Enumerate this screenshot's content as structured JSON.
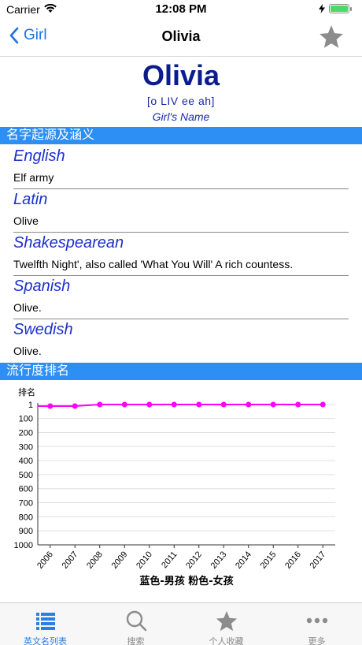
{
  "status": {
    "carrier": "Carrier",
    "time": "12:08 PM"
  },
  "nav": {
    "back_label": "Girl",
    "title": "Olivia"
  },
  "header": {
    "name": "Olivia",
    "pronunciation": "[o LIV ee ah]",
    "gender": "Girl's Name"
  },
  "sections": {
    "origin_title": "名字起源及涵义",
    "popularity_title": "流行度排名"
  },
  "origins": [
    {
      "language": "English",
      "meaning": "Elf army"
    },
    {
      "language": "Latin",
      "meaning": "Olive"
    },
    {
      "language": "Shakespearean",
      "meaning": "Twelfth Night', also called 'What You Will' A rich countess."
    },
    {
      "language": "Spanish",
      "meaning": "Olive."
    },
    {
      "language": "Swedish",
      "meaning": "Olive."
    }
  ],
  "chart_data": {
    "type": "line",
    "ylabel": "排名",
    "xlabel": "蓝色-男孩 粉色-女孩",
    "x": [
      "2006",
      "2007",
      "2008",
      "2009",
      "2010",
      "2011",
      "2012",
      "2013",
      "2014",
      "2015",
      "2016",
      "2017"
    ],
    "series": [
      {
        "color": "#ff00ff",
        "values": [
          1,
          1,
          1,
          1,
          1,
          1,
          1,
          1,
          1,
          1,
          1,
          1
        ]
      }
    ],
    "yticks": [
      1,
      100,
      200,
      300,
      400,
      500,
      600,
      700,
      800,
      900,
      1000
    ],
    "ylim": [
      1,
      1000
    ],
    "y_inverted": true,
    "grid": true
  },
  "tabs": [
    {
      "label": "英文名列表",
      "icon": "list-icon",
      "active": true
    },
    {
      "label": "搜索",
      "icon": "search-icon",
      "active": false
    },
    {
      "label": "个人收藏",
      "icon": "star-icon",
      "active": false
    },
    {
      "label": "更多",
      "icon": "more-icon",
      "active": false
    }
  ],
  "colors": {
    "accent": "#2d8ff3",
    "name_blue": "#0b1d8c",
    "series_pink": "#ff00ff"
  }
}
